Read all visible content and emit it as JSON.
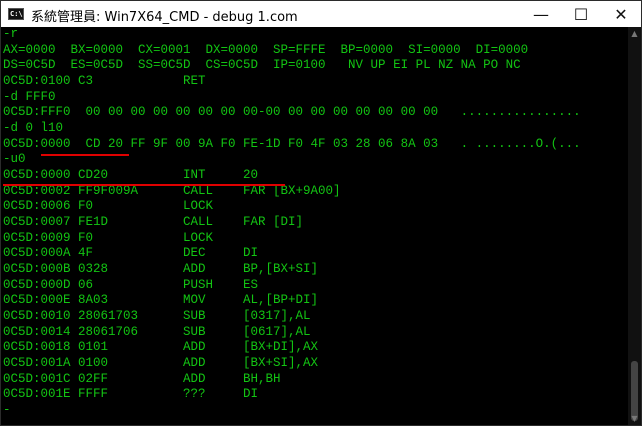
{
  "window": {
    "title": "系統管理員: Win7X64_CMD - debug  1.com",
    "icon_label": "C:\\",
    "minimize_glyph": "—",
    "maximize_glyph": "☐",
    "close_glyph": "✕"
  },
  "terminal": {
    "lines": [
      "-r",
      "AX=0000  BX=0000  CX=0001  DX=0000  SP=FFFE  BP=0000  SI=0000  DI=0000",
      "DS=0C5D  ES=0C5D  SS=0C5D  CS=0C5D  IP=0100   NV UP EI PL NZ NA PO NC",
      "0C5D:0100 C3            RET",
      "-d FFF0",
      "0C5D:FFF0  00 00 00 00 00 00 00 00-00 00 00 00 00 00 00 00   ................",
      "-d 0 l10",
      "0C5D:0000  CD 20 FF 9F 00 9A F0 FE-1D F0 4F 03 28 06 8A 03   . ........O.(...",
      "-u0",
      "0C5D:0000 CD20          INT     20",
      "0C5D:0002 FF9F009A      CALL    FAR [BX+9A00]",
      "0C5D:0006 F0            LOCK",
      "0C5D:0007 FE1D          CALL    FAR [DI]",
      "0C5D:0009 F0            LOCK",
      "0C5D:000A 4F            DEC     DI",
      "0C5D:000B 0328          ADD     BP,[BX+SI]",
      "0C5D:000D 06            PUSH    ES",
      "0C5D:000E 8A03          MOV     AL,[BP+DI]",
      "0C5D:0010 28061703      SUB     [0317],AL",
      "0C5D:0014 28061706      SUB     [0617],AL",
      "0C5D:0018 0101          ADD     [BX+DI],AX",
      "0C5D:001A 0100          ADD     [BX+SI],AX",
      "0C5D:001C 02FF          ADD     BH,BH",
      "0C5D:001E FFFF          ???     DI",
      "-"
    ]
  },
  "colors": {
    "terminal_text": "#13c413",
    "terminal_bg": "#000000",
    "annotation": "#e00000"
  }
}
